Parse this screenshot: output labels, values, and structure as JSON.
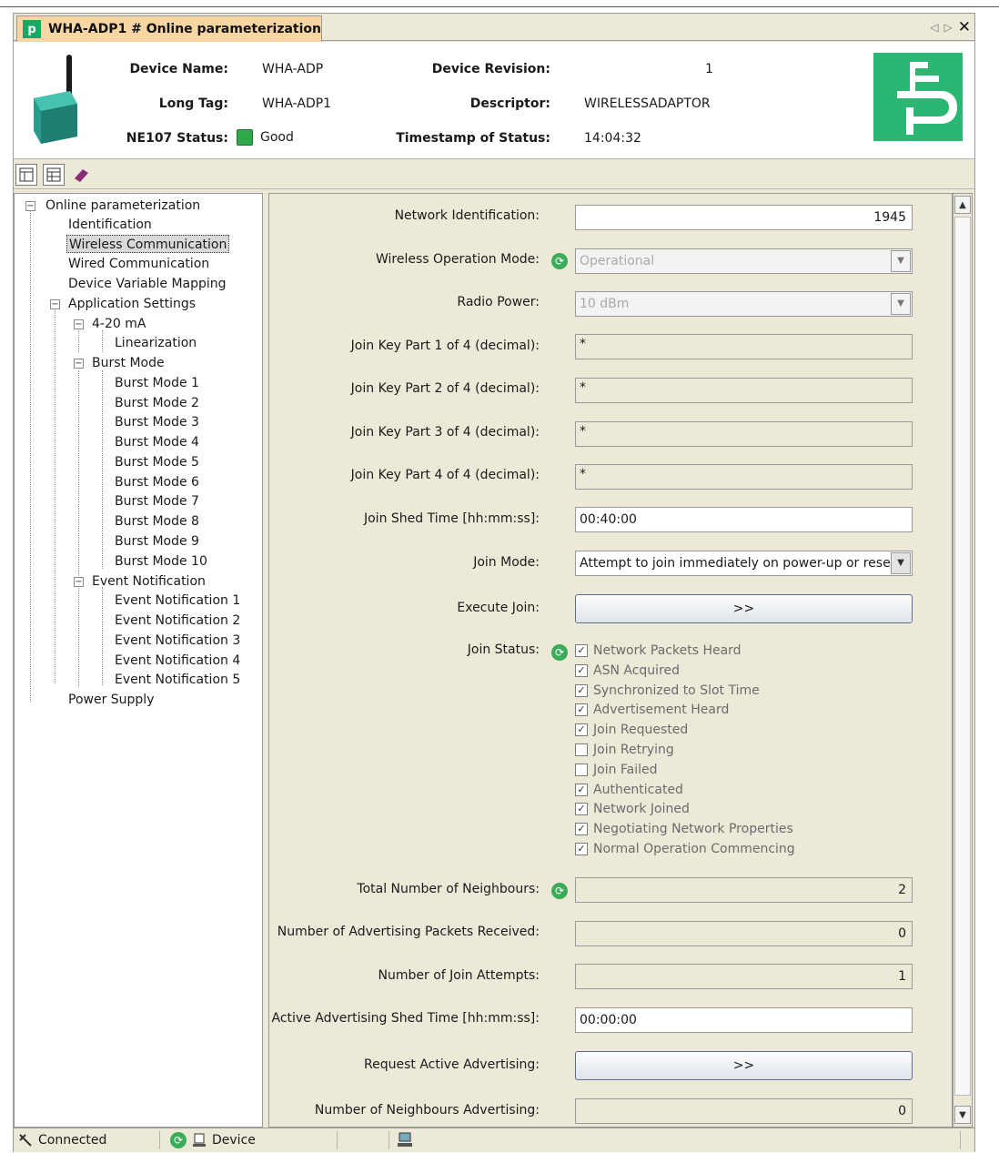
{
  "tab": {
    "title": "WHA-ADP1 # Online parameterization",
    "icon": "pf-logo-icon"
  },
  "header": {
    "device_name_label": "Device Name:",
    "device_name": "WHA-ADP",
    "long_tag_label": "Long Tag:",
    "long_tag": "WHA-ADP1",
    "ne107_label": "NE107 Status:",
    "ne107_status": "Good",
    "device_revision_label": "Device Revision:",
    "device_revision": "1",
    "descriptor_label": "Descriptor:",
    "descriptor": "WIRELESSADAPTOR",
    "timestamp_label": "Timestamp of Status:",
    "timestamp": "14:04:32"
  },
  "colors": {
    "status_good": "#2ea84a",
    "brand": "#2cb673",
    "tab": "#f7d6a4"
  },
  "tree": {
    "root": "Online parameterization",
    "identification": "Identification",
    "wireless": "Wireless Communication",
    "wired": "Wired Communication",
    "mapping": "Device Variable Mapping",
    "app_settings": "Application Settings",
    "ma": "4-20 mA",
    "linearization": "Linearization",
    "burst_mode": "Burst Mode",
    "burst_items": [
      "Burst Mode 1",
      "Burst Mode 2",
      "Burst Mode 3",
      "Burst Mode 4",
      "Burst Mode 5",
      "Burst Mode 6",
      "Burst Mode 7",
      "Burst Mode 8",
      "Burst Mode 9",
      "Burst Mode 10"
    ],
    "event_notification": "Event Notification",
    "event_items": [
      "Event Notification 1",
      "Event Notification 2",
      "Event Notification 3",
      "Event Notification 4",
      "Event Notification 5"
    ],
    "power_supply": "Power Supply"
  },
  "form": {
    "network_id_label": "Network Identification:",
    "network_id": "1945",
    "wireless_mode_label": "Wireless Operation Mode:",
    "wireless_mode": "Operational",
    "radio_power_label": "Radio Power:",
    "radio_power": "10 dBm",
    "join_key1_label": "Join Key Part 1 of 4 (decimal):",
    "join_key1": "*",
    "join_key2_label": "Join Key Part 2 of 4 (decimal):",
    "join_key2": "*",
    "join_key3_label": "Join Key Part 3 of 4 (decimal):",
    "join_key3": "*",
    "join_key4_label": "Join Key Part 4 of 4 (decimal):",
    "join_key4": "*",
    "join_shed_label": "Join Shed Time [hh:mm:ss]:",
    "join_shed": "00:40:00",
    "join_mode_label": "Join Mode:",
    "join_mode": "Attempt to join immediately on power-up or reset",
    "execute_join_label": "Execute Join:",
    "execute_join_button": ">>",
    "join_status_label": "Join Status:",
    "join_status": [
      {
        "label": "Network Packets Heard",
        "checked": true
      },
      {
        "label": "ASN Acquired",
        "checked": true
      },
      {
        "label": "Synchronized to Slot Time",
        "checked": true
      },
      {
        "label": "Advertisement Heard",
        "checked": true
      },
      {
        "label": "Join Requested",
        "checked": true
      },
      {
        "label": "Join Retrying",
        "checked": false
      },
      {
        "label": "Join Failed",
        "checked": false
      },
      {
        "label": "Authenticated",
        "checked": true
      },
      {
        "label": "Network Joined",
        "checked": true
      },
      {
        "label": "Negotiating Network Properties",
        "checked": true
      },
      {
        "label": "Normal Operation Commencing",
        "checked": true
      }
    ],
    "total_neighbours_label": "Total Number of Neighbours:",
    "total_neighbours": "2",
    "adv_packets_label": "Number of Advertising Packets Received:",
    "adv_packets": "0",
    "join_attempts_label": "Number of Join Attempts:",
    "join_attempts": "1",
    "active_adv_shed_label": "Active Advertising Shed Time [hh:mm:ss]:",
    "active_adv_shed": "00:00:00",
    "request_adv_label": "Request Active Advertising:",
    "request_adv_button": ">>",
    "neighbours_adv_label": "Number of Neighbours Advertising:",
    "neighbours_adv": "0"
  },
  "statusbar": {
    "connected": "Connected",
    "device": "Device"
  }
}
